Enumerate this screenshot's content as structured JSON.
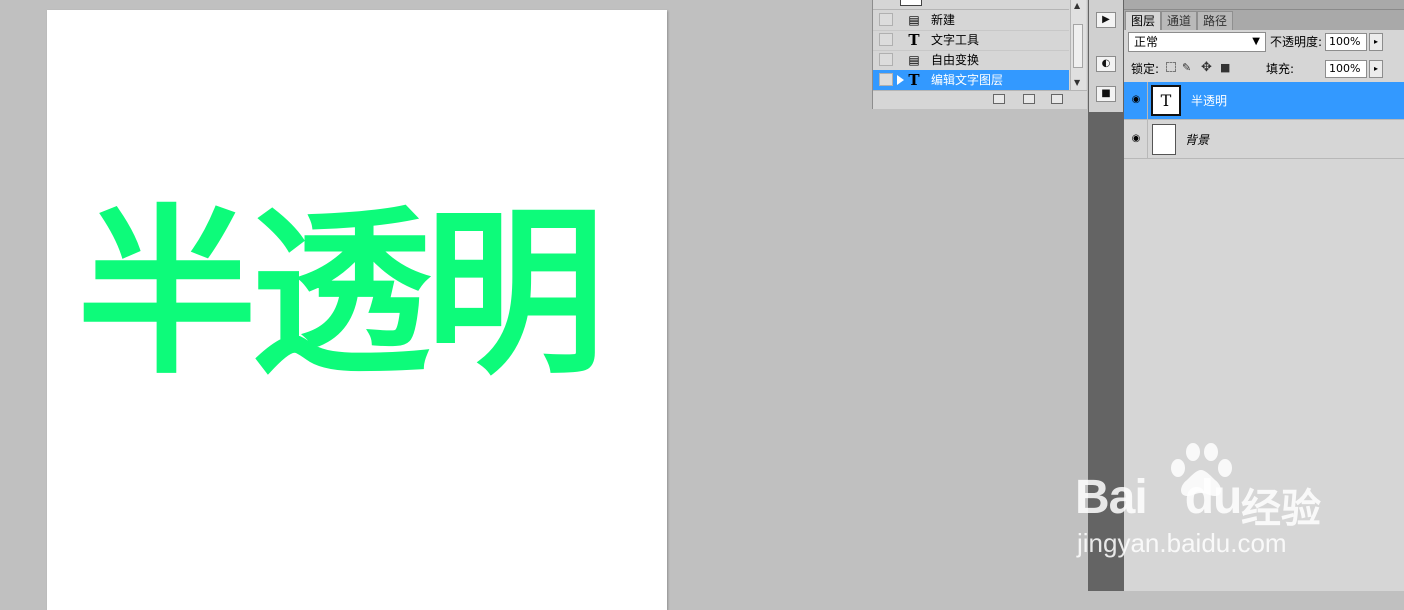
{
  "canvas": {
    "text": "半透明",
    "text_color": "#0dfb7a"
  },
  "history": {
    "items": [
      {
        "label": "新建",
        "icon": "document-icon"
      },
      {
        "label": "文字工具",
        "icon": "text-tool-icon"
      },
      {
        "label": "自由变换",
        "icon": "document-icon"
      },
      {
        "label": "编辑文字图层",
        "icon": "text-tool-icon",
        "selected": true
      }
    ]
  },
  "layers_panel": {
    "tabs": [
      "图层",
      "通道",
      "路径"
    ],
    "blend_mode": "正常",
    "opacity_label": "不透明度:",
    "opacity_value": "100%",
    "lock_label": "锁定:",
    "fill_label": "填充:",
    "fill_value": "100%",
    "layers": [
      {
        "name": "半透明",
        "thumb_glyph": "T",
        "selected": true
      },
      {
        "name": "背景",
        "selected": false
      }
    ]
  },
  "watermark": {
    "brand": "Bai",
    "brand_end": "du",
    "cn": "经验",
    "url": "jingyan.baidu.com"
  },
  "colors": {
    "selection": "#3399ff",
    "panel_bg": "#d6d6d6",
    "workspace_bg": "#c0c0c0"
  }
}
